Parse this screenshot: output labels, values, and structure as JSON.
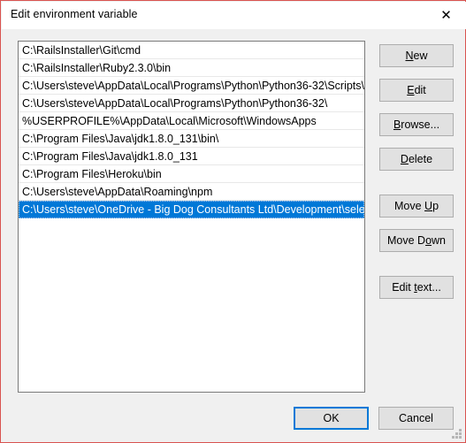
{
  "dialog": {
    "title": "Edit environment variable",
    "border_color": "#d9534f",
    "background_color": "#f0f0f0",
    "close_icon": "close-icon",
    "close_glyph": "✕"
  },
  "listbox": {
    "selected_index": 9,
    "selection_color": "#0078d7",
    "items": [
      "C:\\RailsInstaller\\Git\\cmd",
      "C:\\RailsInstaller\\Ruby2.3.0\\bin",
      "C:\\Users\\steve\\AppData\\Local\\Programs\\Python\\Python36-32\\Scripts\\",
      "C:\\Users\\steve\\AppData\\Local\\Programs\\Python\\Python36-32\\",
      "%USERPROFILE%\\AppData\\Local\\Microsoft\\WindowsApps",
      "C:\\Program Files\\Java\\jdk1.8.0_131\\bin\\",
      "C:\\Program Files\\Java\\jdk1.8.0_131",
      "C:\\Program Files\\Heroku\\bin",
      "C:\\Users\\steve\\AppData\\Roaming\\npm",
      "C:\\Users\\steve\\OneDrive - Big Dog Consultants Ltd\\Development\\sele..."
    ]
  },
  "side_buttons": {
    "new": {
      "label": "New",
      "accel_prefix": "",
      "accel": "N",
      "accel_suffix": "ew"
    },
    "edit": {
      "label": "Edit",
      "accel_prefix": "",
      "accel": "E",
      "accel_suffix": "dit"
    },
    "browse": {
      "label": "Browse...",
      "accel_prefix": "",
      "accel": "B",
      "accel_suffix": "rowse..."
    },
    "delete": {
      "label": "Delete",
      "accel_prefix": "",
      "accel": "D",
      "accel_suffix": "elete"
    },
    "move_up": {
      "label": "Move Up",
      "accel_prefix": "Move ",
      "accel": "U",
      "accel_suffix": "p"
    },
    "move_down": {
      "label": "Move Down",
      "accel_prefix": "Move D",
      "accel": "o",
      "accel_suffix": "wn"
    },
    "edit_text": {
      "label": "Edit text...",
      "accel_prefix": "Edit ",
      "accel": "t",
      "accel_suffix": "ext..."
    }
  },
  "footer": {
    "ok_label": "OK",
    "cancel_label": "Cancel",
    "focus_color": "#0078d7",
    "resize_grip": "resize-grip-icon"
  }
}
